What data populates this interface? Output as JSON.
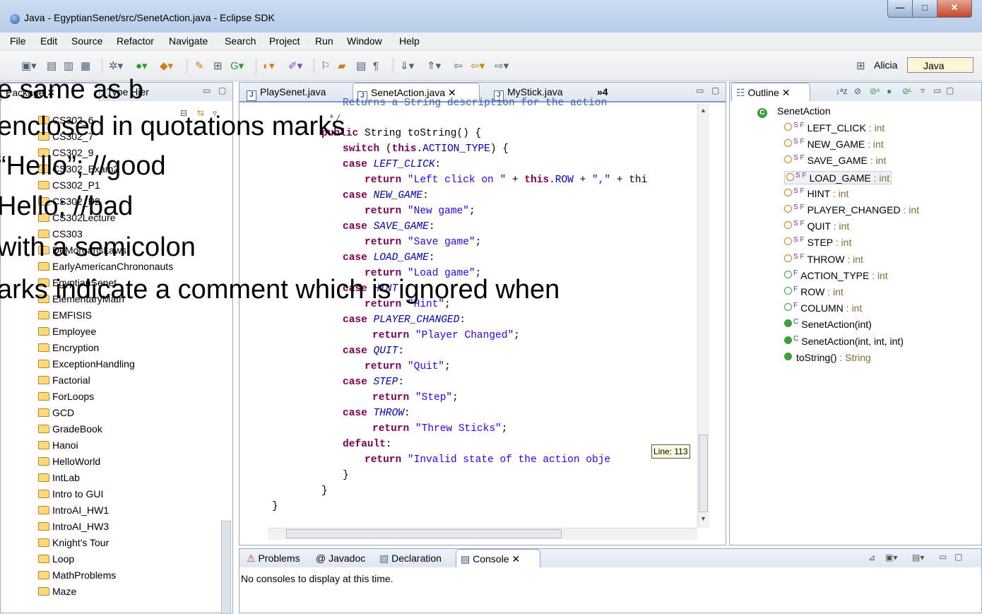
{
  "window": {
    "title": "Java - EgyptianSenet/src/SenetAction.java - Eclipse SDK",
    "minimize": "—",
    "maximize": "□",
    "close": "✕"
  },
  "menu": [
    "File",
    "Edit",
    "Source",
    "Refactor",
    "Navigate",
    "Search",
    "Project",
    "Run",
    "Window",
    "Help"
  ],
  "toolbar": {
    "user": "Alicia",
    "perspective": "Java"
  },
  "left_pane": {
    "tabs": [
      {
        "label": "Package"
      },
      {
        "label": "Type Hier"
      }
    ],
    "projects": [
      "CS302_6",
      "CS302_7",
      "CS302_9",
      "CS302_Exam2",
      "CS302_P1",
      "CS302_P2",
      "CS302Lecture",
      "CS303",
      "DeMorgansLaws",
      "EarlyAmericanChrononauts",
      "EgyptianSenet",
      "ElementaryMath",
      "EMFISIS",
      "Employee",
      "Encryption",
      "ExceptionHandling",
      "Factorial",
      "ForLoops",
      "GCD",
      "GradeBook",
      "Hanoi",
      "HelloWorld",
      "IntLab",
      "Intro to GUI",
      "IntroAI_HW1",
      "IntroAI_HW3",
      "Knight's Tour",
      "Loop",
      "MathProblems",
      "Maze"
    ]
  },
  "editor": {
    "tabs": [
      {
        "label": "PlaySenet.java"
      },
      {
        "label": "SenetAction.java",
        "close": "✕"
      },
      {
        "label": "MyStick.java"
      },
      {
        "label": "»4"
      }
    ],
    "code": {
      "l0": "Returns a String description for the action",
      "l1": "*/",
      "l2a": "public",
      "l2b": " String toString() {",
      "l3a": "switch",
      "l3b": " (",
      "l3c": "this",
      "l3d": ".",
      "l3e": "ACTION_TYPE",
      "l3f": ") {",
      "c1": "case",
      "k1": "LEFT_CLICK",
      "r1": "return",
      "s1": "\"Left click on \"",
      "p1": " + ",
      "t1": "this",
      "f1": ".ROW",
      "s1b": "\",\"",
      "p1b": " + thi",
      "k2": "NEW_GAME",
      "s2": "\"New game\"",
      "k3": "SAVE_GAME",
      "s3": "\"Save game\"",
      "k4": "LOAD_GAME",
      "s4": "\"Load game\"",
      "k5": "HINT",
      "s5": "\"Hint\"",
      "k6": "PLAYER_CHANGED",
      "s6": "\"Player Changed\"",
      "k7": "QUIT",
      "s7": "\"Quit\"",
      "k8": "STEP",
      "s8": "\"Step\"",
      "k9": "THROW",
      "s9": "\"Threw Sticks\"",
      "def": "default",
      "s10": "\"Invalid state of the action obje",
      "colon": ":",
      "semi": ";",
      "close1": "}",
      "close2": "}",
      "close3": "}"
    },
    "tooltip": "Line: 113"
  },
  "outline": {
    "tab": "Outline",
    "class": "SenetAction",
    "members": [
      {
        "mods": "S F",
        "name": "LEFT_CLICK",
        "type": " : int"
      },
      {
        "mods": "S F",
        "name": "NEW_GAME",
        "type": " : int"
      },
      {
        "mods": "S F",
        "name": "SAVE_GAME",
        "type": " : int"
      },
      {
        "mods": "S F",
        "name": "LOAD_GAME",
        "type": " : int"
      },
      {
        "mods": "S F",
        "name": "HINT",
        "type": " : int"
      },
      {
        "mods": "S F",
        "name": "PLAYER_CHANGED",
        "type": " : int"
      },
      {
        "mods": "S F",
        "name": "QUIT",
        "type": " : int"
      },
      {
        "mods": "S F",
        "name": "STEP",
        "type": " : int"
      },
      {
        "mods": "S F",
        "name": "THROW",
        "type": " : int"
      },
      {
        "mods": "F",
        "name": "ACTION_TYPE",
        "type": " : int"
      },
      {
        "mods": "F",
        "name": "ROW",
        "type": " : int"
      },
      {
        "mods": "F",
        "name": "COLUMN",
        "type": " : int"
      },
      {
        "mods": "C",
        "name": "SenetAction(int)",
        "type": ""
      },
      {
        "mods": "C",
        "name": "SenetAction(int, int, int)",
        "type": ""
      },
      {
        "mods": "",
        "name": "toString()",
        "type": " : String"
      }
    ]
  },
  "bottom": {
    "tabs": [
      {
        "label": "Problems"
      },
      {
        "label": "Javadoc"
      },
      {
        "label": "Declaration"
      },
      {
        "label": "Console",
        "close": "✕"
      }
    ],
    "message": "No consoles to display at this time."
  },
  "overlay": [
    "e same as b",
    "enclosed in quotations marks",
    "“Hello”;  //good",
    "Hello; //bad",
    " with a semicolon",
    "arks indicate a comment which is ignored when"
  ],
  "colors": {
    "accent": "#9aaac4",
    "keyword": "#7f0055",
    "string": "#2a00ff",
    "constant": "#0000c0"
  }
}
